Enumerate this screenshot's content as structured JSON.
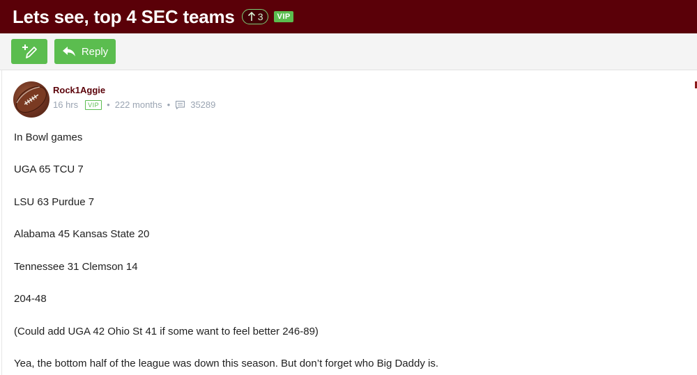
{
  "thread": {
    "title": "Lets see, top 4 SEC teams",
    "votes": "3",
    "vip_label": "VIP"
  },
  "toolbar": {
    "new_post_icon": "pencil-plus-icon",
    "reply_label": "Reply",
    "reply_icon": "reply-arrow-icon"
  },
  "post": {
    "author": "Rock1Aggie",
    "time": "16 hrs",
    "vip_label": "VIP",
    "member_for": "222 months",
    "post_count": "35289",
    "lines": [
      "In Bowl games",
      "UGA 65 TCU 7",
      "LSU 63 Purdue 7",
      "Alabama 45 Kansas State 20",
      "Tennessee 31 Clemson 14",
      "204-48",
      "(Could add UGA 42 Ohio St 41 if some want to feel better 246-89)",
      "Yea, the bottom half of the league was down this season. But don’t forget who Big Daddy is."
    ]
  },
  "colors": {
    "header_bg": "#5a0008",
    "accent_green": "#5bbd4f",
    "username": "#5a0008",
    "meta_gray": "#9aa4b2"
  }
}
